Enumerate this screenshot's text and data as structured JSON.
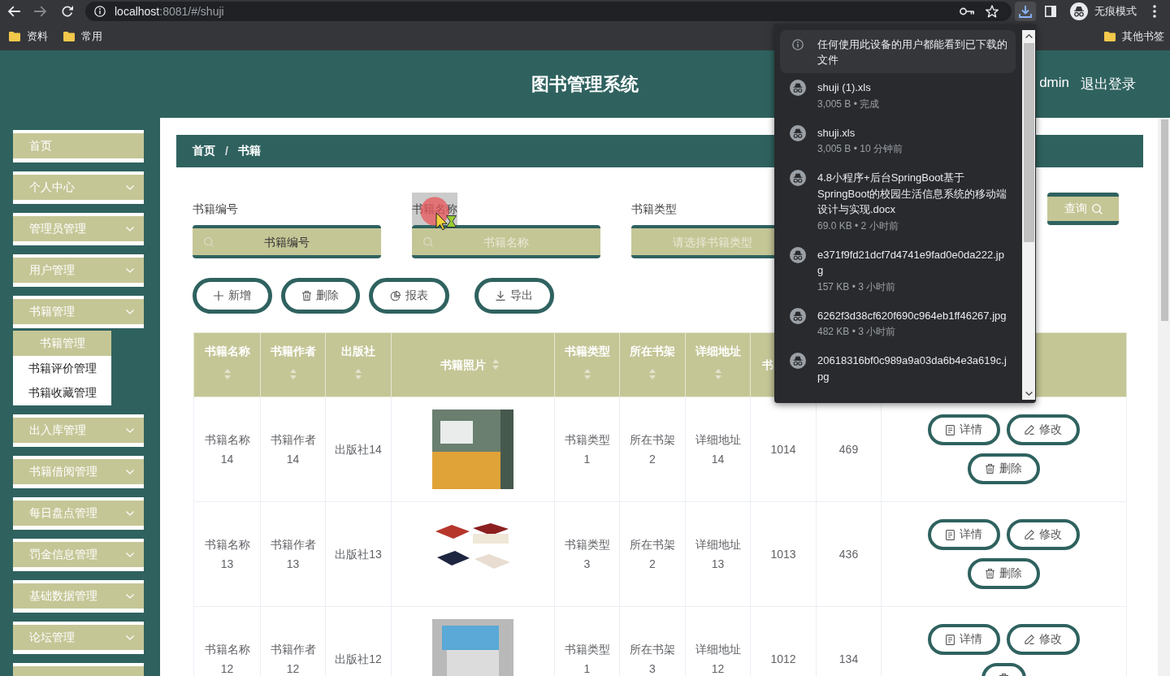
{
  "browser": {
    "url": {
      "host": "localhost",
      "path": ":8081/#/shuji"
    },
    "profile": "无痕模式",
    "bookmarks": [
      {
        "label": "资料"
      },
      {
        "label": "常用"
      }
    ],
    "other_bookmarks": "其他书签"
  },
  "downloads": {
    "notice": "任何使用此设备的用户都能看到已下载的文件",
    "items": [
      {
        "name": "shuji (1).xls",
        "meta": "3,005 B • 完成"
      },
      {
        "name": "shuji.xls",
        "meta": "3,005 B • 10 分钟前"
      },
      {
        "name": "4.8小程序+后台SpringBoot基于SpringBoot的校园生活信息系统的移动端设计与实现.docx",
        "meta": "69.0 KB • 2 小时前"
      },
      {
        "name": "e371f9fd21dcf7d4741e9fad0e0da222.jpg",
        "meta": "157 KB • 3 小时前"
      },
      {
        "name": "6262f3d38cf620f690c964eb1ff46267.jpg",
        "meta": "482 KB • 3 小时前"
      },
      {
        "name": "20618316bf0c989a9a03da6b4e3a619c.jpg"
      }
    ]
  },
  "header": {
    "title": "图书管理系统",
    "user": "dmin",
    "logout": "退出登录"
  },
  "sidebar": {
    "items": [
      {
        "label": "首页",
        "kind": "link"
      },
      {
        "label": "个人中心",
        "kind": "submenu"
      },
      {
        "label": "管理员管理",
        "kind": "submenu"
      },
      {
        "label": "用户管理",
        "kind": "submenu"
      },
      {
        "label": "书籍管理",
        "kind": "submenu",
        "children": [
          {
            "label": "书籍管理",
            "selected": true
          },
          {
            "label": "书籍评价管理",
            "selected": false
          },
          {
            "label": "书籍收藏管理",
            "selected": false
          }
        ]
      },
      {
        "label": "出入库管理",
        "kind": "submenu"
      },
      {
        "label": "书籍借阅管理",
        "kind": "submenu"
      },
      {
        "label": "每日盘点管理",
        "kind": "submenu"
      },
      {
        "label": "罚金信息管理",
        "kind": "submenu"
      },
      {
        "label": "基础数据管理",
        "kind": "submenu"
      },
      {
        "label": "论坛管理",
        "kind": "submenu"
      },
      {
        "kind": "submenu"
      }
    ]
  },
  "breadcrumb": {
    "items": [
      {
        "label": "首页"
      },
      {
        "label": "书籍"
      }
    ],
    "separator": "/"
  },
  "search": {
    "fields": [
      {
        "label": "书籍编号",
        "label_selected": false,
        "kind": "text",
        "placeholder": "书籍编号",
        "placeholder_selected": true
      },
      {
        "label": "书籍名称",
        "label_selected": true,
        "kind": "text",
        "placeholder": "书籍名称",
        "placeholder_selected": false
      },
      {
        "label": "书籍类型",
        "label_selected": false,
        "kind": "select",
        "placeholder": "请选择书籍类型",
        "placeholder_selected": false
      }
    ],
    "button": "查询"
  },
  "toolbar": {
    "buttons": [
      {
        "kind": "add",
        "label": "新增"
      },
      {
        "kind": "delete",
        "label": "删除"
      },
      {
        "kind": "report",
        "label": "报表"
      },
      {
        "kind": "export",
        "label": "导出"
      }
    ]
  },
  "table": {
    "columns": [
      {
        "label": "书籍名称",
        "sortable": true
      },
      {
        "label": "书籍作者",
        "sortable": true
      },
      {
        "label": "出版社",
        "sortable": true
      },
      {
        "label": "书籍照片",
        "sortable": true
      },
      {
        "label": "书籍类型",
        "sortable": true
      },
      {
        "label": "所在书架",
        "sortable": true
      },
      {
        "label": "详细地址",
        "sortable": true
      },
      {
        "label": "书"
      }
    ],
    "rows": [
      {
        "book_name": "书籍名称14",
        "author": "书籍作者14",
        "publisher": "出版社14",
        "photo": {
          "kind": "box-set"
        },
        "book_type": "书籍类型1",
        "shelf": "所在书架2",
        "address": "详细地址14",
        "column_8": "1014",
        "column_9": "469",
        "actions": [
          {
            "kind": "detail",
            "label": "详情"
          },
          {
            "kind": "edit",
            "label": "修改"
          },
          {
            "kind": "delete",
            "label": "删除"
          }
        ]
      },
      {
        "book_name": "书籍名称13",
        "author": "书籍作者13",
        "publisher": "出版社13",
        "photo": {
          "kind": "books"
        },
        "book_type": "书籍类型3",
        "shelf": "所在书架2",
        "address": "详细地址13",
        "column_8": "1013",
        "column_9": "436",
        "actions": [
          {
            "kind": "detail",
            "label": "详情"
          },
          {
            "kind": "edit",
            "label": "修改"
          },
          {
            "kind": "delete",
            "label": "删除"
          }
        ]
      },
      {
        "book_name": "书籍名称12",
        "author": "书籍作者12",
        "publisher": "出版社12",
        "photo": {
          "kind": "stack"
        },
        "book_type": "书籍类型1",
        "shelf": "所在书架3",
        "address": "详细地址12",
        "column_8": "1012",
        "column_9": "134",
        "actions": [
          {
            "kind": "detail",
            "label": "详情"
          },
          {
            "kind": "edit",
            "label": "修改"
          },
          {
            "kind": "delete"
          }
        ]
      }
    ]
  }
}
